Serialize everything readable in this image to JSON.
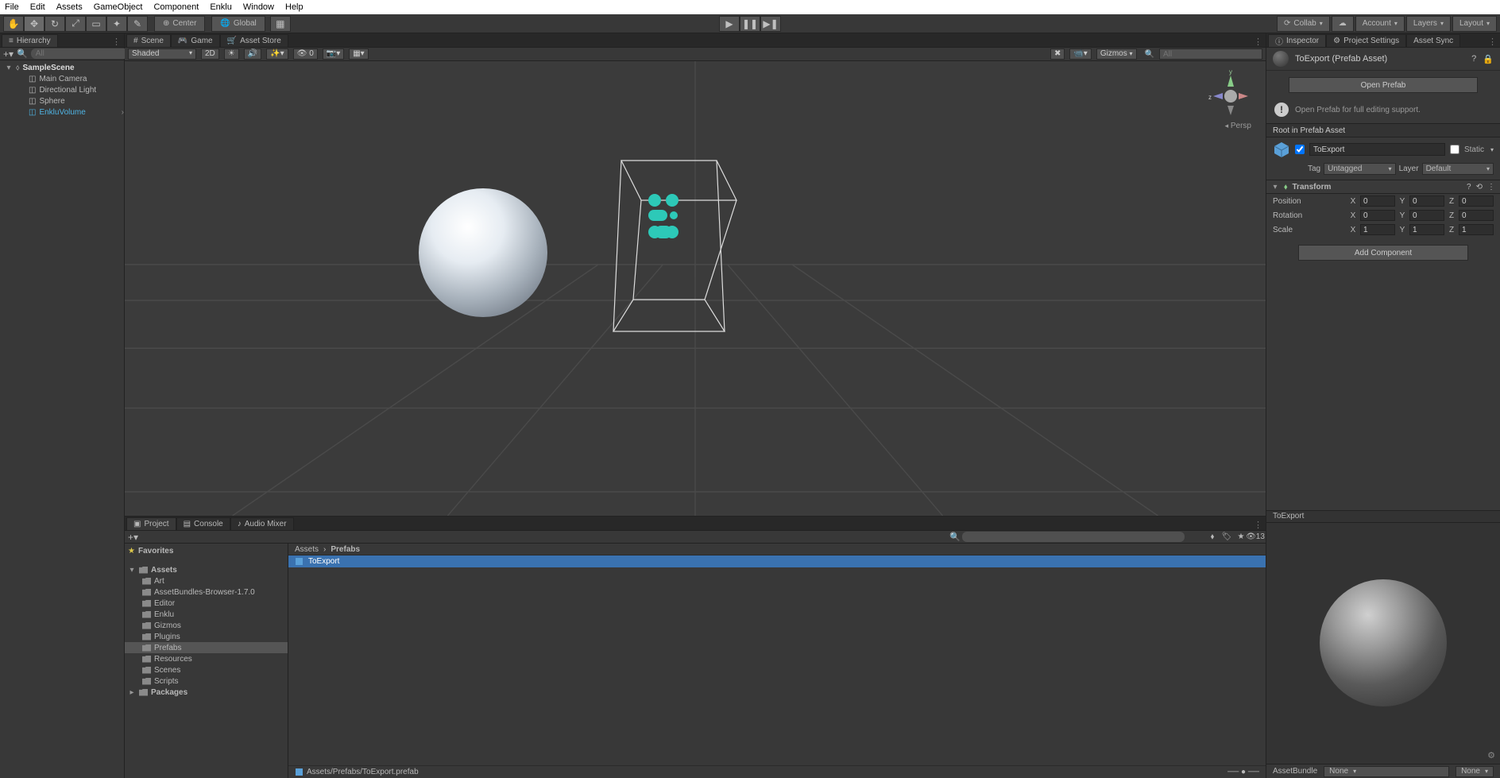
{
  "menubar": [
    "File",
    "Edit",
    "Assets",
    "GameObject",
    "Component",
    "Enklu",
    "Window",
    "Help"
  ],
  "toolbar": {
    "pivot_center": "Center",
    "pivot_global": "Global",
    "collab": "Collab",
    "account": "Account",
    "layers": "Layers",
    "layout": "Layout"
  },
  "hierarchy": {
    "tab": "Hierarchy",
    "search_placeholder": "All",
    "scene": "SampleScene",
    "items": [
      "Main Camera",
      "Directional Light",
      "Sphere",
      "EnkluVolume"
    ],
    "selected": "EnkluVolume"
  },
  "scene": {
    "tabs": [
      "Scene",
      "Game",
      "Asset Store"
    ],
    "shaded": "Shaded",
    "two_d": "2D",
    "gizmos": "Gizmos",
    "search_placeholder": "All",
    "persp": "Persp",
    "lights_badge": "0"
  },
  "project": {
    "tabs": [
      "Project",
      "Console",
      "Audio Mixer"
    ],
    "hidden_count": "13",
    "favorites": "Favorites",
    "assets": "Assets",
    "folders": [
      "Art",
      "AssetBundles-Browser-1.7.0",
      "Editor",
      "Enklu",
      "Gizmos",
      "Plugins",
      "Prefabs",
      "Resources",
      "Scenes",
      "Scripts"
    ],
    "packages": "Packages",
    "selected_folder": "Prefabs",
    "breadcrumb": [
      "Assets",
      "Prefabs"
    ],
    "items": [
      {
        "name": "ToExport",
        "selected": true
      }
    ],
    "status_path": "Assets/Prefabs/ToExport.prefab"
  },
  "inspector": {
    "tabs": [
      "Inspector",
      "Project Settings",
      "Asset Sync"
    ],
    "title": "ToExport (Prefab Asset)",
    "open_prefab": "Open Prefab",
    "hint": "Open Prefab for full editing support.",
    "root_section": "Root in Prefab Asset",
    "object_name": "ToExport",
    "enabled": true,
    "static": "Static",
    "tag_label": "Tag",
    "tag_value": "Untagged",
    "layer_label": "Layer",
    "layer_value": "Default",
    "transform": {
      "title": "Transform",
      "position": {
        "label": "Position",
        "x": "0",
        "y": "0",
        "z": "0"
      },
      "rotation": {
        "label": "Rotation",
        "x": "0",
        "y": "0",
        "z": "0"
      },
      "scale": {
        "label": "Scale",
        "x": "1",
        "y": "1",
        "z": "1"
      }
    },
    "add_component": "Add Component",
    "preview_title": "ToExport",
    "assetbundle_label": "AssetBundle",
    "assetbundle_value": "None",
    "assetbundle_variant": "None"
  }
}
